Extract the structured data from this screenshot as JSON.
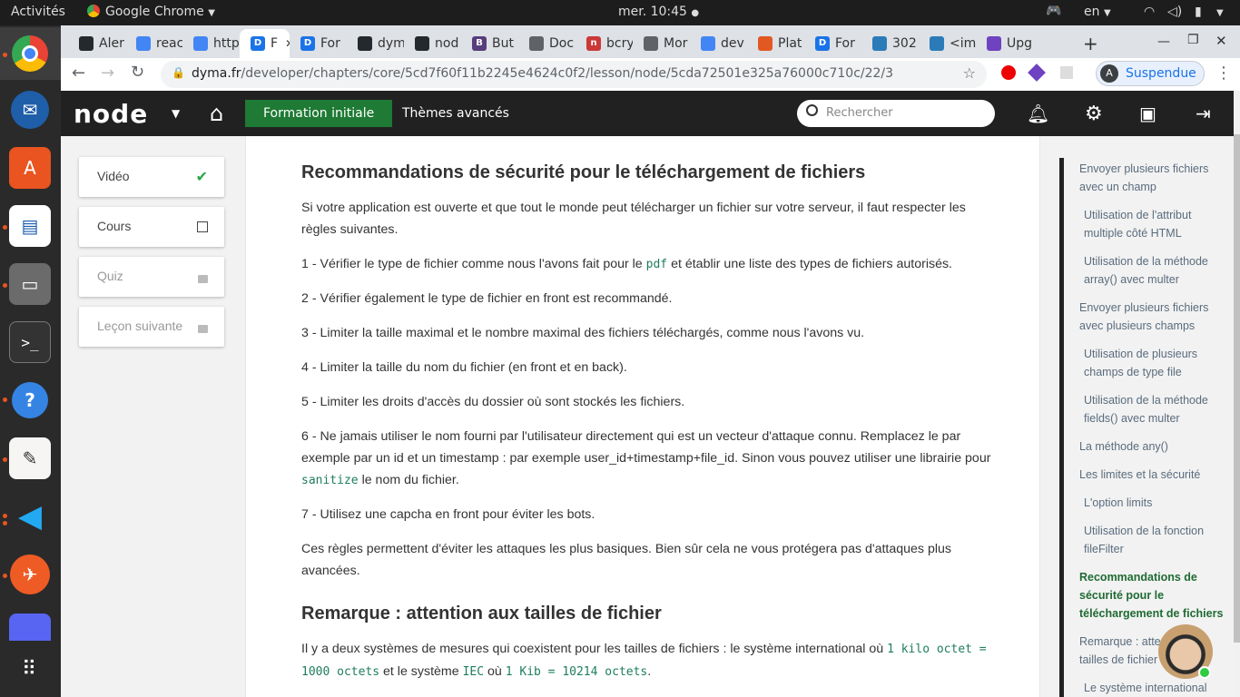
{
  "system": {
    "activities": "Activités",
    "app": "Google Chrome",
    "clock": "mer. 10:45",
    "lang": "en"
  },
  "dock": [
    "chrome-icon",
    "thunderbird-icon",
    "software-icon",
    "writer-icon",
    "files-icon",
    "terminal-icon",
    "help-icon",
    "text-editor-icon",
    "vscode-icon",
    "postman-icon",
    "discord-icon",
    "apps-grid-icon"
  ],
  "tabs": [
    {
      "label": "Aler",
      "fav": "github",
      "color": "#24292e"
    },
    {
      "label": "reac",
      "fav": "google",
      "color": "#4285f4"
    },
    {
      "label": "http",
      "fav": "google",
      "color": "#4285f4"
    },
    {
      "label": "F",
      "fav": "D",
      "color": "#1a73e8",
      "active": true
    },
    {
      "label": "For",
      "fav": "D",
      "color": "#1a73e8"
    },
    {
      "label": "dym",
      "fav": "github",
      "color": "#24292e"
    },
    {
      "label": "nod",
      "fav": "github",
      "color": "#24292e"
    },
    {
      "label": "But",
      "fav": "B",
      "color": "#563d7c"
    },
    {
      "label": "Doc",
      "fav": "globe",
      "color": "#5f6368"
    },
    {
      "label": "bcry",
      "fav": "n",
      "color": "#cb3837"
    },
    {
      "label": "Mor",
      "fav": "globe",
      "color": "#5f6368"
    },
    {
      "label": "dev",
      "fav": "google",
      "color": "#4285f4"
    },
    {
      "label": "Plat",
      "fav": "plat",
      "color": "#e25822"
    },
    {
      "label": "For",
      "fav": "D",
      "color": "#1a73e8"
    },
    {
      "label": "302",
      "fav": "fox",
      "color": "#2b7bb9"
    },
    {
      "label": "<im",
      "fav": "fox",
      "color": "#2b7bb9"
    },
    {
      "label": "Upg",
      "fav": "gem",
      "color": "#6f42c1"
    }
  ],
  "address": {
    "domain": "dyma.fr",
    "path": "/developer/chapters/core/5cd7f60f11b2245e4624c0f2/lesson/node/5cda72501e325a76000c710c/22/3"
  },
  "profile": {
    "initial": "A",
    "label": "Suspendue"
  },
  "sitenav": {
    "logo": "node",
    "formation": "Formation initiale",
    "themes": "Thèmes avancés",
    "search_placeholder": "Rechercher"
  },
  "lesson_menu": [
    {
      "label": "Vidéo",
      "state": "done"
    },
    {
      "label": "Cours",
      "state": "unchecked"
    },
    {
      "label": "Quiz",
      "state": "locked"
    },
    {
      "label": "Leçon suivante",
      "state": "locked"
    }
  ],
  "content": {
    "h1": "Recommandations de sécurité pour le téléchargement de fichiers",
    "intro": "Si votre application est ouverte et que tout le monde peut télécharger un fichier sur votre serveur, il faut respecter les règles suivantes.",
    "r1a": "1 - Vérifier le type de fichier comme nous l'avons fait pour le ",
    "r1code": "pdf",
    "r1b": " et établir une liste des types de fichiers autorisés.",
    "r2": "2 - Vérifier également le type de fichier en front est recommandé.",
    "r3": "3 - Limiter la taille maximal et le nombre maximal des fichiers téléchargés, comme nous l'avons vu.",
    "r4": "4 - Limiter la taille du nom du fichier (en front et en back).",
    "r5": "5 - Limiter les droits d'accès du dossier où sont stockés les fichiers.",
    "r6a": "6 - Ne jamais utiliser le nom fourni par l'utilisateur directement qui est un vecteur d'attaque connu. Remplacez le par exemple par un id et un timestamp : par exemple user_id+timestamp+file_id. Sinon vous pouvez utiliser une librairie pour ",
    "r6code": "sanitize",
    "r6b": " le nom du fichier.",
    "r7": "7 - Utilisez une capcha en front pour éviter les bots.",
    "outro": "Ces règles permettent d'éviter les attaques les plus basiques. Bien sûr cela ne vous protégera pas d'attaques plus avancées.",
    "h2": "Remarque : attention aux tailles de fichier",
    "s1": "Il y a deux systèmes de mesures qui coexistent pour les tailles de fichiers : le système international où ",
    "s1code": "1 kilo octet = 1000 octets",
    "s2": " et le système ",
    "s2code": "IEC",
    "s3": " où ",
    "s3code": "1 Kib = 10214 octets",
    "s4": "."
  },
  "toc": [
    {
      "label": "Envoyer plusieurs fichiers avec un champ",
      "level": 1
    },
    {
      "label": "Utilisation de l'attribut multiple côté HTML",
      "level": 2
    },
    {
      "label": "Utilisation de la méthode array() avec multer",
      "level": 2
    },
    {
      "label": "Envoyer plusieurs fichiers avec plusieurs champs",
      "level": 1
    },
    {
      "label": "Utilisation de plusieurs champs de type file",
      "level": 2
    },
    {
      "label": "Utilisation de la méthode fields() avec multer",
      "level": 2
    },
    {
      "label": "La méthode any()",
      "level": 1
    },
    {
      "label": "Les limites et la sécurité",
      "level": 1
    },
    {
      "label": "L'option limits",
      "level": 2
    },
    {
      "label": "Utilisation de la fonction fileFilter",
      "level": 2
    },
    {
      "label": "Recommandations de sécurité pour le téléchargement de fichiers",
      "level": 1,
      "active": true
    },
    {
      "label": "Remarque : attention aux tailles de fichier",
      "level": 1
    },
    {
      "label": "Le système international",
      "level": 2
    }
  ]
}
